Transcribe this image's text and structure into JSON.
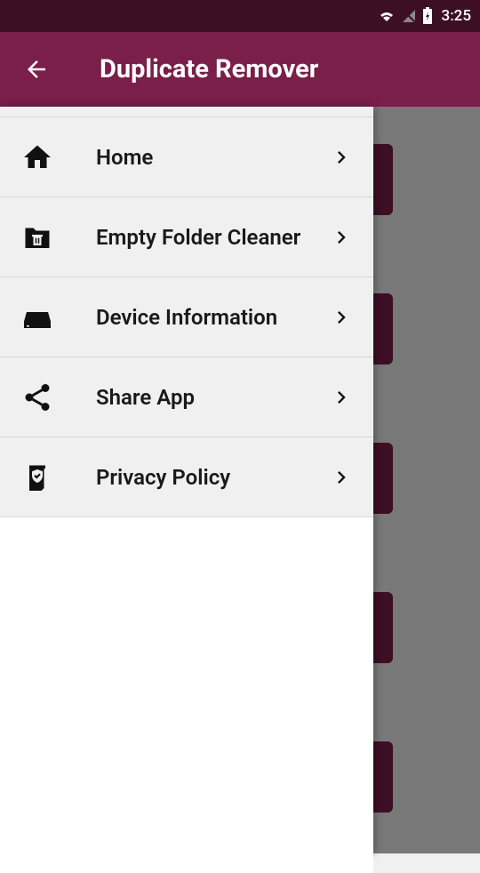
{
  "status_bar": {
    "time": "3:25"
  },
  "header": {
    "title": "Duplicate Remover"
  },
  "menu": {
    "items": [
      {
        "label": "Home",
        "icon": "home-icon"
      },
      {
        "label": "Empty Folder Cleaner",
        "icon": "folder-trash-icon"
      },
      {
        "label": "Device Information",
        "icon": "device-icon"
      },
      {
        "label": "Share App",
        "icon": "share-icon"
      },
      {
        "label": "Privacy Policy",
        "icon": "privacy-icon"
      }
    ]
  }
}
